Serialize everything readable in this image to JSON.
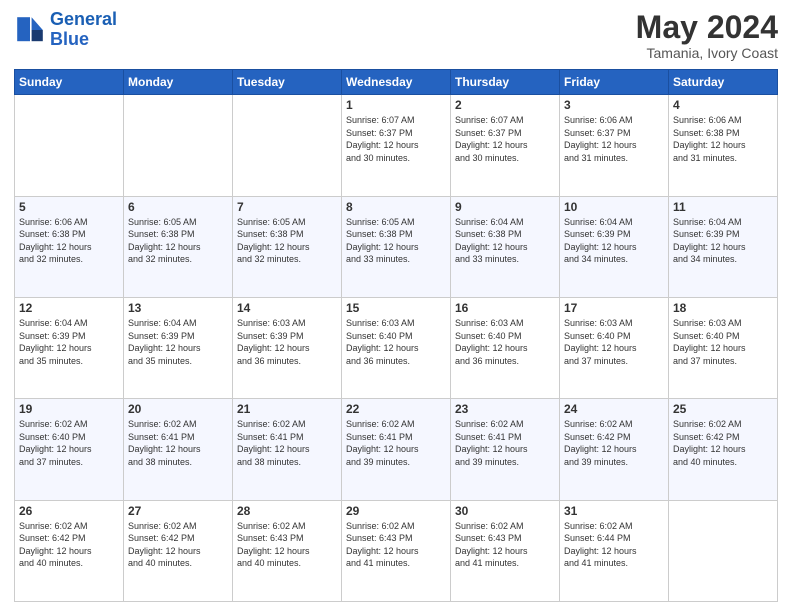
{
  "header": {
    "logo_line1": "General",
    "logo_line2": "Blue",
    "main_title": "May 2024",
    "subtitle": "Tamania, Ivory Coast"
  },
  "weekdays": [
    "Sunday",
    "Monday",
    "Tuesday",
    "Wednesday",
    "Thursday",
    "Friday",
    "Saturday"
  ],
  "weeks": [
    [
      {
        "day": "",
        "info": ""
      },
      {
        "day": "",
        "info": ""
      },
      {
        "day": "",
        "info": ""
      },
      {
        "day": "1",
        "info": "Sunrise: 6:07 AM\nSunset: 6:37 PM\nDaylight: 12 hours\nand 30 minutes."
      },
      {
        "day": "2",
        "info": "Sunrise: 6:07 AM\nSunset: 6:37 PM\nDaylight: 12 hours\nand 30 minutes."
      },
      {
        "day": "3",
        "info": "Sunrise: 6:06 AM\nSunset: 6:37 PM\nDaylight: 12 hours\nand 31 minutes."
      },
      {
        "day": "4",
        "info": "Sunrise: 6:06 AM\nSunset: 6:38 PM\nDaylight: 12 hours\nand 31 minutes."
      }
    ],
    [
      {
        "day": "5",
        "info": "Sunrise: 6:06 AM\nSunset: 6:38 PM\nDaylight: 12 hours\nand 32 minutes."
      },
      {
        "day": "6",
        "info": "Sunrise: 6:05 AM\nSunset: 6:38 PM\nDaylight: 12 hours\nand 32 minutes."
      },
      {
        "day": "7",
        "info": "Sunrise: 6:05 AM\nSunset: 6:38 PM\nDaylight: 12 hours\nand 32 minutes."
      },
      {
        "day": "8",
        "info": "Sunrise: 6:05 AM\nSunset: 6:38 PM\nDaylight: 12 hours\nand 33 minutes."
      },
      {
        "day": "9",
        "info": "Sunrise: 6:04 AM\nSunset: 6:38 PM\nDaylight: 12 hours\nand 33 minutes."
      },
      {
        "day": "10",
        "info": "Sunrise: 6:04 AM\nSunset: 6:39 PM\nDaylight: 12 hours\nand 34 minutes."
      },
      {
        "day": "11",
        "info": "Sunrise: 6:04 AM\nSunset: 6:39 PM\nDaylight: 12 hours\nand 34 minutes."
      }
    ],
    [
      {
        "day": "12",
        "info": "Sunrise: 6:04 AM\nSunset: 6:39 PM\nDaylight: 12 hours\nand 35 minutes."
      },
      {
        "day": "13",
        "info": "Sunrise: 6:04 AM\nSunset: 6:39 PM\nDaylight: 12 hours\nand 35 minutes."
      },
      {
        "day": "14",
        "info": "Sunrise: 6:03 AM\nSunset: 6:39 PM\nDaylight: 12 hours\nand 36 minutes."
      },
      {
        "day": "15",
        "info": "Sunrise: 6:03 AM\nSunset: 6:40 PM\nDaylight: 12 hours\nand 36 minutes."
      },
      {
        "day": "16",
        "info": "Sunrise: 6:03 AM\nSunset: 6:40 PM\nDaylight: 12 hours\nand 36 minutes."
      },
      {
        "day": "17",
        "info": "Sunrise: 6:03 AM\nSunset: 6:40 PM\nDaylight: 12 hours\nand 37 minutes."
      },
      {
        "day": "18",
        "info": "Sunrise: 6:03 AM\nSunset: 6:40 PM\nDaylight: 12 hours\nand 37 minutes."
      }
    ],
    [
      {
        "day": "19",
        "info": "Sunrise: 6:02 AM\nSunset: 6:40 PM\nDaylight: 12 hours\nand 37 minutes."
      },
      {
        "day": "20",
        "info": "Sunrise: 6:02 AM\nSunset: 6:41 PM\nDaylight: 12 hours\nand 38 minutes."
      },
      {
        "day": "21",
        "info": "Sunrise: 6:02 AM\nSunset: 6:41 PM\nDaylight: 12 hours\nand 38 minutes."
      },
      {
        "day": "22",
        "info": "Sunrise: 6:02 AM\nSunset: 6:41 PM\nDaylight: 12 hours\nand 39 minutes."
      },
      {
        "day": "23",
        "info": "Sunrise: 6:02 AM\nSunset: 6:41 PM\nDaylight: 12 hours\nand 39 minutes."
      },
      {
        "day": "24",
        "info": "Sunrise: 6:02 AM\nSunset: 6:42 PM\nDaylight: 12 hours\nand 39 minutes."
      },
      {
        "day": "25",
        "info": "Sunrise: 6:02 AM\nSunset: 6:42 PM\nDaylight: 12 hours\nand 40 minutes."
      }
    ],
    [
      {
        "day": "26",
        "info": "Sunrise: 6:02 AM\nSunset: 6:42 PM\nDaylight: 12 hours\nand 40 minutes."
      },
      {
        "day": "27",
        "info": "Sunrise: 6:02 AM\nSunset: 6:42 PM\nDaylight: 12 hours\nand 40 minutes."
      },
      {
        "day": "28",
        "info": "Sunrise: 6:02 AM\nSunset: 6:43 PM\nDaylight: 12 hours\nand 40 minutes."
      },
      {
        "day": "29",
        "info": "Sunrise: 6:02 AM\nSunset: 6:43 PM\nDaylight: 12 hours\nand 41 minutes."
      },
      {
        "day": "30",
        "info": "Sunrise: 6:02 AM\nSunset: 6:43 PM\nDaylight: 12 hours\nand 41 minutes."
      },
      {
        "day": "31",
        "info": "Sunrise: 6:02 AM\nSunset: 6:44 PM\nDaylight: 12 hours\nand 41 minutes."
      },
      {
        "day": "",
        "info": ""
      }
    ]
  ]
}
